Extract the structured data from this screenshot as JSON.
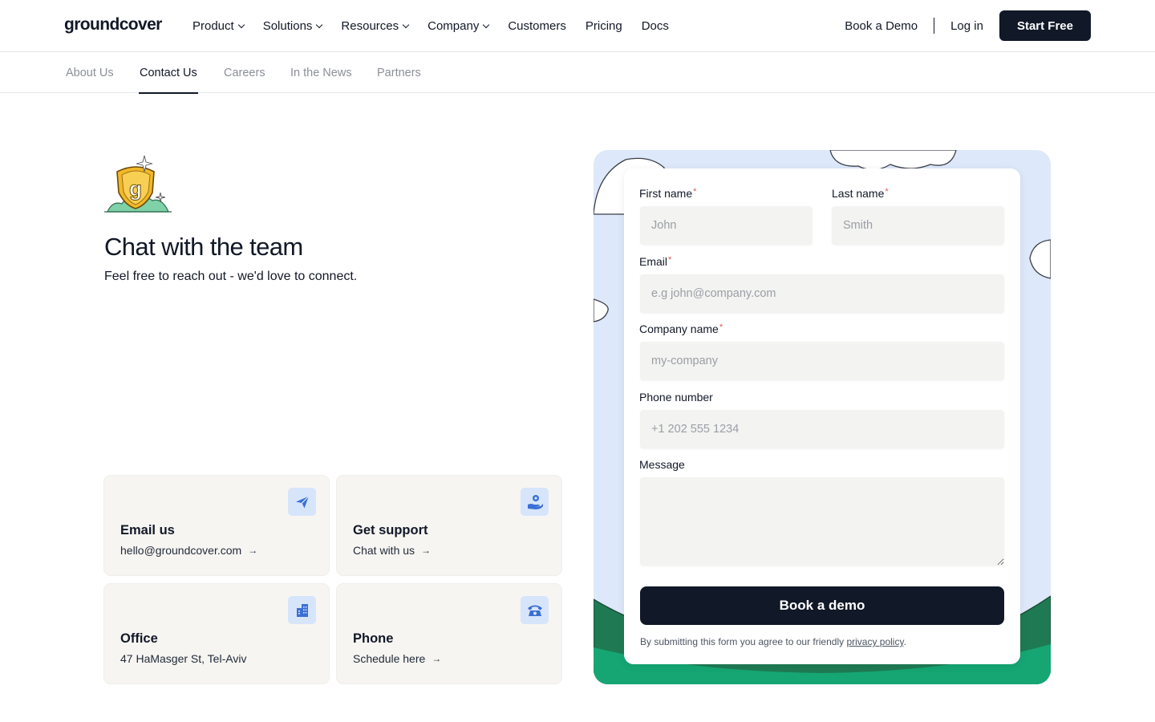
{
  "brand": {
    "logo": "groundcover"
  },
  "nav": {
    "items": [
      {
        "label": "Product",
        "dropdown": true
      },
      {
        "label": "Solutions",
        "dropdown": true
      },
      {
        "label": "Resources",
        "dropdown": true
      },
      {
        "label": "Company",
        "dropdown": true
      },
      {
        "label": "Customers",
        "dropdown": false
      },
      {
        "label": "Pricing",
        "dropdown": false
      },
      {
        "label": "Docs",
        "dropdown": false
      }
    ],
    "book_demo": "Book a Demo",
    "login": "Log in",
    "start_free": "Start Free"
  },
  "subnav": {
    "tabs": [
      "About Us",
      "Contact Us",
      "Careers",
      "In the News",
      "Partners"
    ],
    "active": "Contact Us"
  },
  "hero": {
    "title": "Chat with the team",
    "subtitle": "Feel free to reach out - we'd love to connect."
  },
  "cards": [
    {
      "title": "Email us",
      "line": "hello@groundcover.com",
      "arrow": "→",
      "icon": "paper-plane-icon"
    },
    {
      "title": "Get support",
      "line": "Chat with us",
      "arrow": "→",
      "icon": "hand-support-icon"
    },
    {
      "title": "Office",
      "line": "47 HaMasger St, Tel-Aviv",
      "arrow": "",
      "icon": "building-icon"
    },
    {
      "title": "Phone",
      "line": "Schedule here",
      "arrow": "→",
      "icon": "telephone-icon"
    }
  ],
  "form": {
    "first_name": {
      "label": "First name",
      "required": "*",
      "placeholder": "John",
      "value": ""
    },
    "last_name": {
      "label": "Last name",
      "required": "*",
      "placeholder": "Smith",
      "value": ""
    },
    "email": {
      "label": "Email",
      "required": "*",
      "placeholder": "e.g john@company.com",
      "value": ""
    },
    "company": {
      "label": "Company name",
      "required": "*",
      "placeholder": "my-company",
      "value": ""
    },
    "phone": {
      "label": "Phone number",
      "placeholder": "+1 202 555 1234",
      "value": ""
    },
    "message": {
      "label": "Message",
      "value": ""
    },
    "submit": "Book a demo",
    "consent_text": "By submitting this form you agree to our friendly ",
    "consent_link": "privacy policy",
    "consent_end": "."
  },
  "colors": {
    "primary": "#111827",
    "card_bg": "#f7f5f2",
    "icon_bg": "#d7e5fb",
    "icon_fg": "#3b6fd4",
    "panel_sky": "#dde8fa",
    "hill_dark": "#1f7a53",
    "hill_light": "#15a673",
    "required": "#e25555"
  }
}
